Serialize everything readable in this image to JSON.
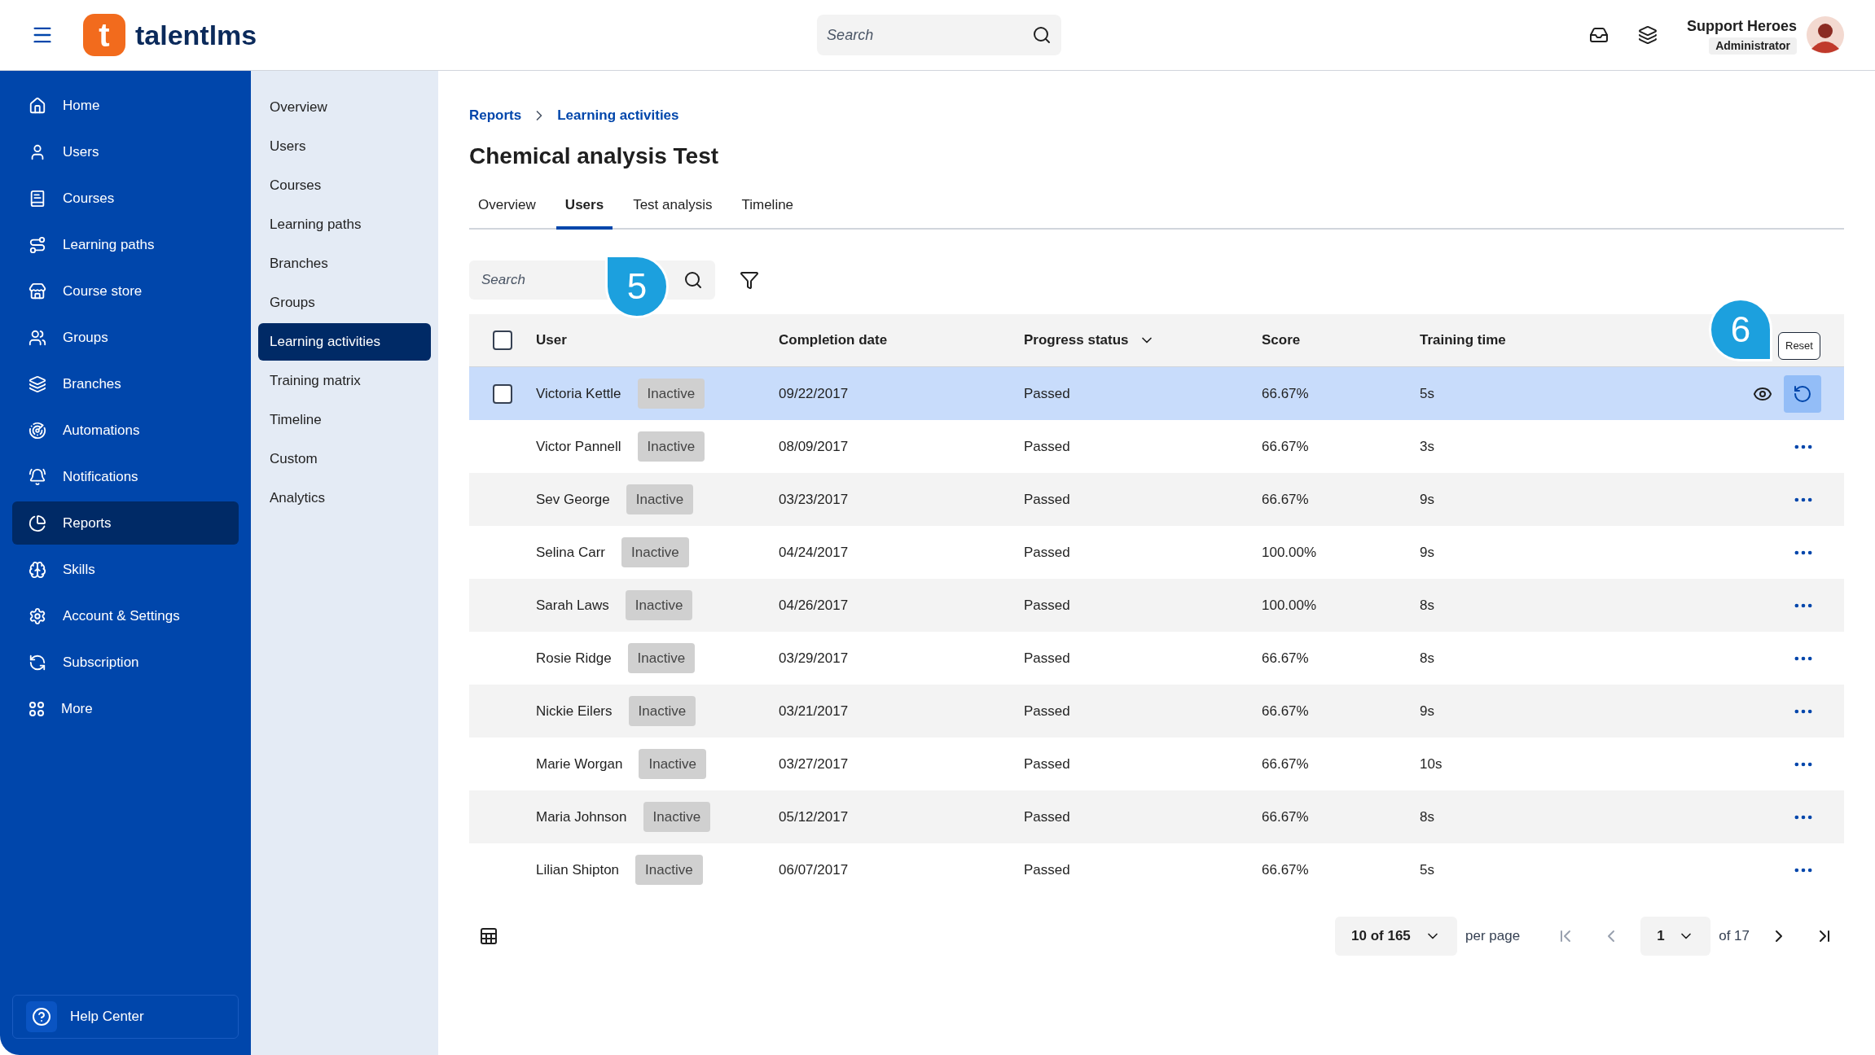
{
  "topbar": {
    "logo_mark": "t",
    "logo_text": "talentlms",
    "search": {
      "placeholder": "Search"
    },
    "user": {
      "name": "Support Heroes",
      "role": "Administrator"
    }
  },
  "sidebar": {
    "items": [
      {
        "label": "Home",
        "selected": false
      },
      {
        "label": "Users",
        "selected": false
      },
      {
        "label": "Courses",
        "selected": false
      },
      {
        "label": "Learning paths",
        "selected": false
      },
      {
        "label": "Course store",
        "selected": false
      },
      {
        "label": "Groups",
        "selected": false
      },
      {
        "label": "Branches",
        "selected": false
      },
      {
        "label": "Automations",
        "selected": false
      },
      {
        "label": "Notifications",
        "selected": false
      },
      {
        "label": "Reports",
        "selected": true
      },
      {
        "label": "Skills",
        "selected": false
      },
      {
        "label": "Account & Settings",
        "selected": false
      },
      {
        "label": "Subscription",
        "selected": false
      },
      {
        "label": "More",
        "selected": false
      }
    ],
    "help": "Help Center"
  },
  "subnav": {
    "items": [
      {
        "label": "Overview",
        "selected": false
      },
      {
        "label": "Users",
        "selected": false
      },
      {
        "label": "Courses",
        "selected": false
      },
      {
        "label": "Learning paths",
        "selected": false
      },
      {
        "label": "Branches",
        "selected": false
      },
      {
        "label": "Groups",
        "selected": false
      },
      {
        "label": "Learning activities",
        "selected": true
      },
      {
        "label": "Training matrix",
        "selected": false
      },
      {
        "label": "Timeline",
        "selected": false
      },
      {
        "label": "Custom",
        "selected": false
      },
      {
        "label": "Analytics",
        "selected": false
      }
    ]
  },
  "breadcrumb": [
    "Reports",
    "Learning activities"
  ],
  "title": "Chemical analysis Test",
  "tabs": [
    {
      "label": "Overview",
      "selected": false
    },
    {
      "label": "Users",
      "selected": true
    },
    {
      "label": "Test analysis",
      "selected": false
    },
    {
      "label": "Timeline",
      "selected": false
    }
  ],
  "table_search": {
    "placeholder": "Search"
  },
  "table": {
    "select_all_checked": false,
    "columns": [
      "User",
      "Completion date",
      "Progress status",
      "Score",
      "Training time"
    ],
    "rows": [
      {
        "user": "Victoria Kettle",
        "status": "Inactive",
        "completion_date": "09/22/2017",
        "progress_status": "Passed",
        "score": "66.67%",
        "training_time": "5s",
        "selected": true
      },
      {
        "user": "Victor Pannell",
        "status": "Inactive",
        "completion_date": "08/09/2017",
        "progress_status": "Passed",
        "score": "66.67%",
        "training_time": "3s",
        "selected": false
      },
      {
        "user": "Sev George",
        "status": "Inactive",
        "completion_date": "03/23/2017",
        "progress_status": "Passed",
        "score": "66.67%",
        "training_time": "9s",
        "selected": false
      },
      {
        "user": "Selina Carr",
        "status": "Inactive",
        "completion_date": "04/24/2017",
        "progress_status": "Passed",
        "score": "100.00%",
        "training_time": "9s",
        "selected": false
      },
      {
        "user": "Sarah Laws",
        "status": "Inactive",
        "completion_date": "04/26/2017",
        "progress_status": "Passed",
        "score": "100.00%",
        "training_time": "8s",
        "selected": false
      },
      {
        "user": "Rosie Ridge",
        "status": "Inactive",
        "completion_date": "03/29/2017",
        "progress_status": "Passed",
        "score": "66.67%",
        "training_time": "8s",
        "selected": false
      },
      {
        "user": "Nickie Eilers",
        "status": "Inactive",
        "completion_date": "03/21/2017",
        "progress_status": "Passed",
        "score": "66.67%",
        "training_time": "9s",
        "selected": false
      },
      {
        "user": "Marie Worgan",
        "status": "Inactive",
        "completion_date": "03/27/2017",
        "progress_status": "Passed",
        "score": "66.67%",
        "training_time": "10s",
        "selected": false
      },
      {
        "user": "Maria Johnson",
        "status": "Inactive",
        "completion_date": "05/12/2017",
        "progress_status": "Passed",
        "score": "66.67%",
        "training_time": "8s",
        "selected": false
      },
      {
        "user": "Lilian Shipton",
        "status": "Inactive",
        "completion_date": "06/07/2017",
        "progress_status": "Passed",
        "score": "66.67%",
        "training_time": "5s",
        "selected": false
      }
    ]
  },
  "tooltip": "Reset",
  "callouts": [
    "5",
    "6"
  ],
  "pagination": {
    "per_page_value": "10 of 165",
    "per_page_label": "per page",
    "page": "1",
    "page_total": "of 17"
  }
}
